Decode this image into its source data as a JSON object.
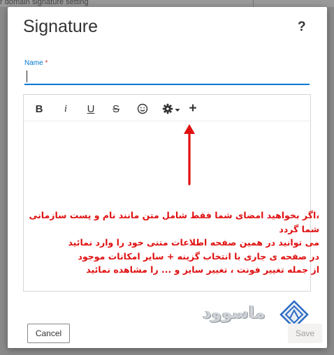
{
  "backdrop": {
    "partial_text": "r domain signature setting"
  },
  "dialog": {
    "title": "Signature",
    "help_label": "?"
  },
  "name_field": {
    "label": "Name",
    "required_mark": "*",
    "value": ""
  },
  "toolbar": {
    "bold": "B",
    "italic": "i",
    "underline": "U",
    "strikethrough": "S",
    "emoji_icon": "smiley-icon",
    "settings_icon": "gear-dropdown-icon",
    "insert": "+"
  },
  "annotation": {
    "lines": [
      "،اگر بخواهید امضای شما فقط شامل متن مانند نام و پست سازمانی شما گردد",
      "می توانید در همین صفحه اطلاعات متنی خود را وارد نمائید",
      "در صفحه ی جاری با انتخاب گزینه + سایر امکانات موجود",
      "از جمله تغییر فونت ، تغییر سایز و ... را مشاهده نمائید"
    ],
    "color": "#e01010"
  },
  "watermark": {
    "text": "ماسوود"
  },
  "footer": {
    "cancel_label": "Cancel",
    "save_label": "Save"
  },
  "colors": {
    "accent": "#0078d4",
    "required": "#d13438",
    "arrow": "#e01010"
  }
}
